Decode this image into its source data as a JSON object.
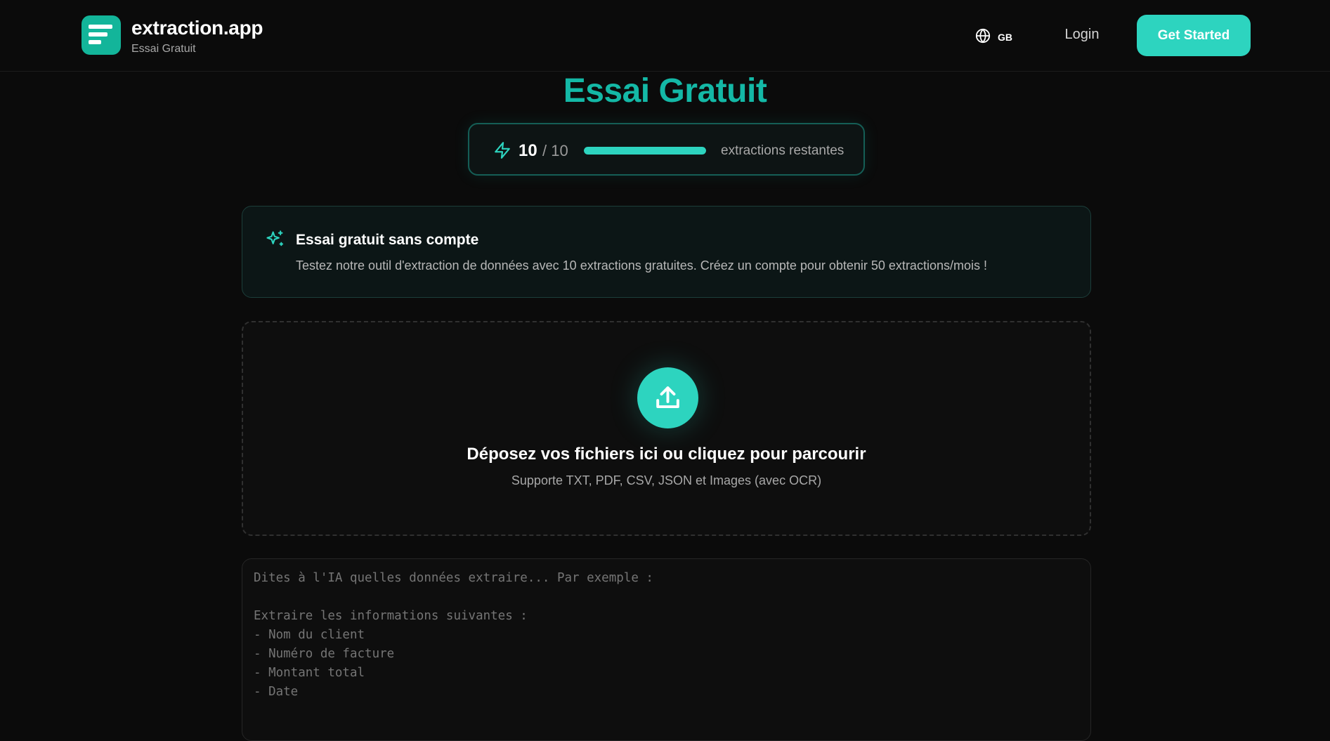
{
  "header": {
    "brand_name": "extraction.app",
    "brand_subtitle": "Essai Gratuit",
    "logo_icon": "document-lines-icon",
    "language": {
      "icon": "globe-icon",
      "code": "GB"
    },
    "login_label": "Login",
    "cta_label": "Get Started"
  },
  "main": {
    "title": "Essai Gratuit",
    "quota": {
      "icon": "lightning-icon",
      "remaining": "10",
      "total": "/ 10",
      "progress_fraction": 1.0,
      "label": "extractions restantes"
    },
    "notice": {
      "icon": "sparkles-icon",
      "title": "Essai gratuit sans compte",
      "text": "Testez notre outil d'extraction de données avec 10 extractions gratuites. Créez un compte pour obtenir 50 extractions/mois !"
    },
    "dropzone": {
      "icon": "upload-icon",
      "title": "Déposez vos fichiers ici ou cliquez pour parcourir",
      "subtitle": "Supporte TXT, PDF, CSV, JSON et Images (avec OCR)"
    },
    "prompt": {
      "placeholder": "Dites à l'IA quelles données extraire... Par exemple :\n\nExtraire les informations suivantes :\n- Nom du client\n- Numéro de facture\n- Montant total\n- Date"
    }
  },
  "colors": {
    "accent": "#2dd4bf",
    "title": "#14b8a6",
    "background": "#0b0b0b"
  }
}
